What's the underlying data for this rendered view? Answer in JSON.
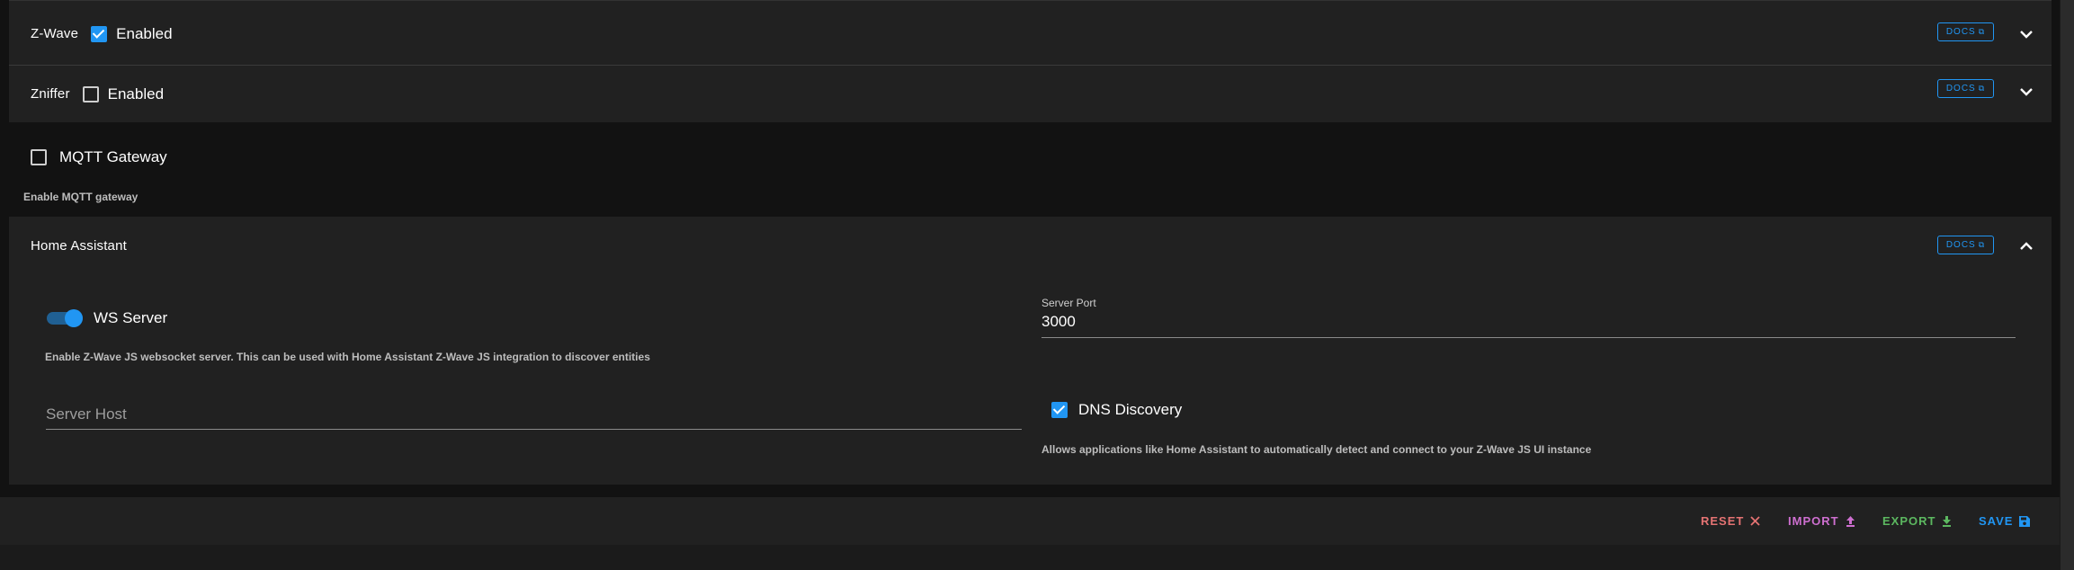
{
  "zwave": {
    "title": "Z-Wave",
    "enabled_label": "Enabled",
    "enabled": true,
    "docs_label": "DOCS"
  },
  "zniffer": {
    "title": "Zniffer",
    "enabled_label": "Enabled",
    "enabled": false,
    "docs_label": "DOCS"
  },
  "mqtt": {
    "label": "MQTT Gateway",
    "checked": false,
    "hint": "Enable MQTT gateway"
  },
  "home_assistant": {
    "title": "Home Assistant",
    "docs_label": "DOCS",
    "ws_server": {
      "label": "WS Server",
      "on": true,
      "hint": "Enable Z-Wave JS websocket server. This can be used with Home Assistant Z-Wave JS integration to discover entities"
    },
    "server_port": {
      "label": "Server Port",
      "value": "3000"
    },
    "server_host": {
      "placeholder": "Server Host"
    },
    "dns_discovery": {
      "label": "DNS Discovery",
      "checked": true,
      "hint": "Allows applications like Home Assistant to automatically detect and connect to your Z-Wave JS UI instance"
    }
  },
  "footer": {
    "reset_label": "RESET",
    "import_label": "IMPORT",
    "export_label": "EXPORT",
    "save_label": "SAVE"
  },
  "colors": {
    "accent": "#2196f3",
    "reset": "#e57373",
    "import": "#ce6fd0",
    "export": "#5cb860",
    "background": "#121212",
    "panel": "#212121"
  }
}
